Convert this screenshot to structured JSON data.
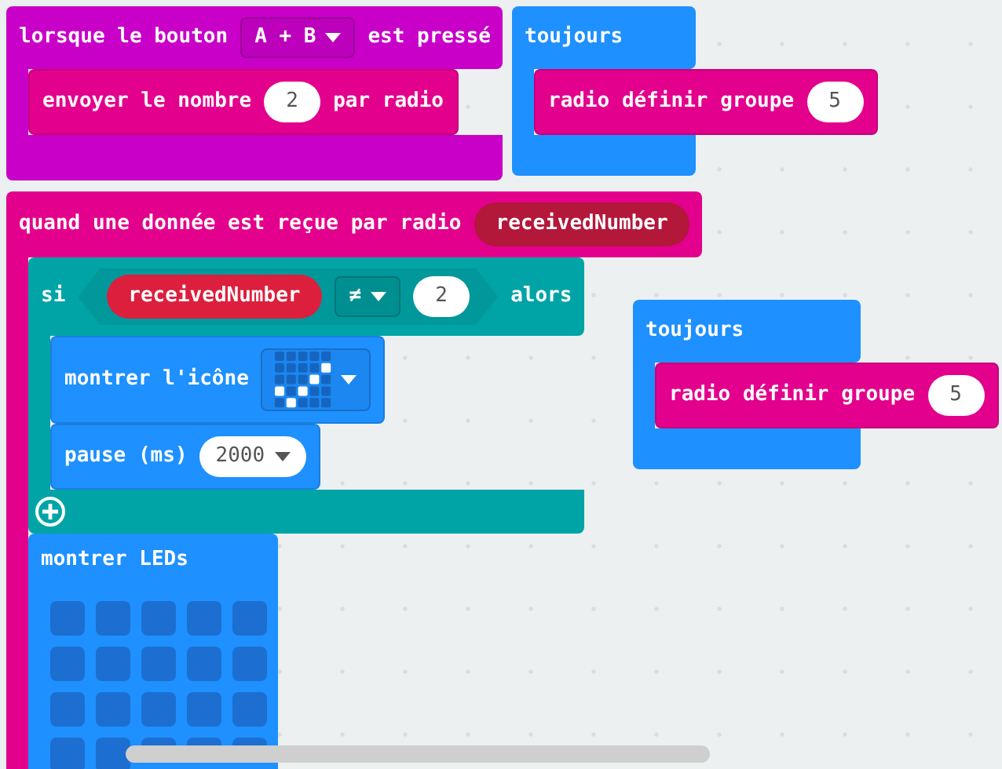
{
  "blocks": [
    {
      "kind": "event",
      "color": "#c800c8",
      "parts": [
        {
          "kind": "text",
          "text": "lorsque le bouton"
        },
        {
          "kind": "dropdown",
          "text": "A + B"
        },
        {
          "kind": "text",
          "text": "est pressé"
        }
      ],
      "body": [
        {
          "kind": "statement",
          "color": "#e3008c",
          "parts": [
            {
              "kind": "text",
              "text": "envoyer le nombre"
            },
            {
              "kind": "number",
              "text": "2"
            },
            {
              "kind": "text",
              "text": "par radio"
            }
          ]
        }
      ]
    },
    {
      "kind": "event",
      "color": "#1e90ff",
      "parts": [
        {
          "kind": "text",
          "text": "toujours"
        }
      ],
      "body": [
        {
          "kind": "statement",
          "color": "#e3008c",
          "parts": [
            {
              "kind": "text",
              "text": "radio définir groupe"
            },
            {
              "kind": "number",
              "text": "5"
            }
          ]
        }
      ]
    },
    {
      "kind": "event",
      "color": "#e3008c",
      "parts": [
        {
          "kind": "text",
          "text": "quand une donnée est reçue par radio"
        },
        {
          "kind": "variable",
          "text": "receivedNumber"
        }
      ],
      "body": [
        {
          "kind": "if",
          "color": "#00a4a6",
          "parts": [
            {
              "kind": "text",
              "text": "si"
            },
            {
              "kind": "condition",
              "parts": [
                {
                  "kind": "variable",
                  "text": "receivedNumber"
                },
                {
                  "kind": "operator",
                  "text": "≠"
                },
                {
                  "kind": "number",
                  "text": "2"
                }
              ]
            },
            {
              "kind": "text",
              "text": "alors"
            }
          ],
          "body": [
            {
              "kind": "statement",
              "color": "#1e90ff",
              "parts": [
                {
                  "kind": "text",
                  "text": "montrer l'icône"
                },
                {
                  "kind": "icon_picker"
                }
              ]
            },
            {
              "kind": "statement",
              "color": "#1e90ff",
              "parts": [
                {
                  "kind": "text",
                  "text": "pause (ms)"
                },
                {
                  "kind": "number_dropdown",
                  "text": "2000"
                }
              ]
            }
          ]
        },
        {
          "kind": "leds",
          "color": "#1e90ff",
          "parts": [
            {
              "kind": "text",
              "text": "montrer LEDs"
            }
          ],
          "leds": [
            [
              false,
              false,
              false,
              false,
              false
            ],
            [
              false,
              false,
              false,
              false,
              false
            ],
            [
              false,
              false,
              false,
              false,
              false
            ],
            [
              false,
              false,
              false,
              false,
              false
            ]
          ]
        }
      ]
    },
    {
      "kind": "event",
      "color": "#1e90ff",
      "parts": [
        {
          "kind": "text",
          "text": "toujours"
        }
      ],
      "body": [
        {
          "kind": "statement",
          "color": "#e3008c",
          "parts": [
            {
              "kind": "text",
              "text": "radio définir groupe"
            },
            {
              "kind": "number",
              "text": "5"
            }
          ]
        }
      ]
    }
  ]
}
